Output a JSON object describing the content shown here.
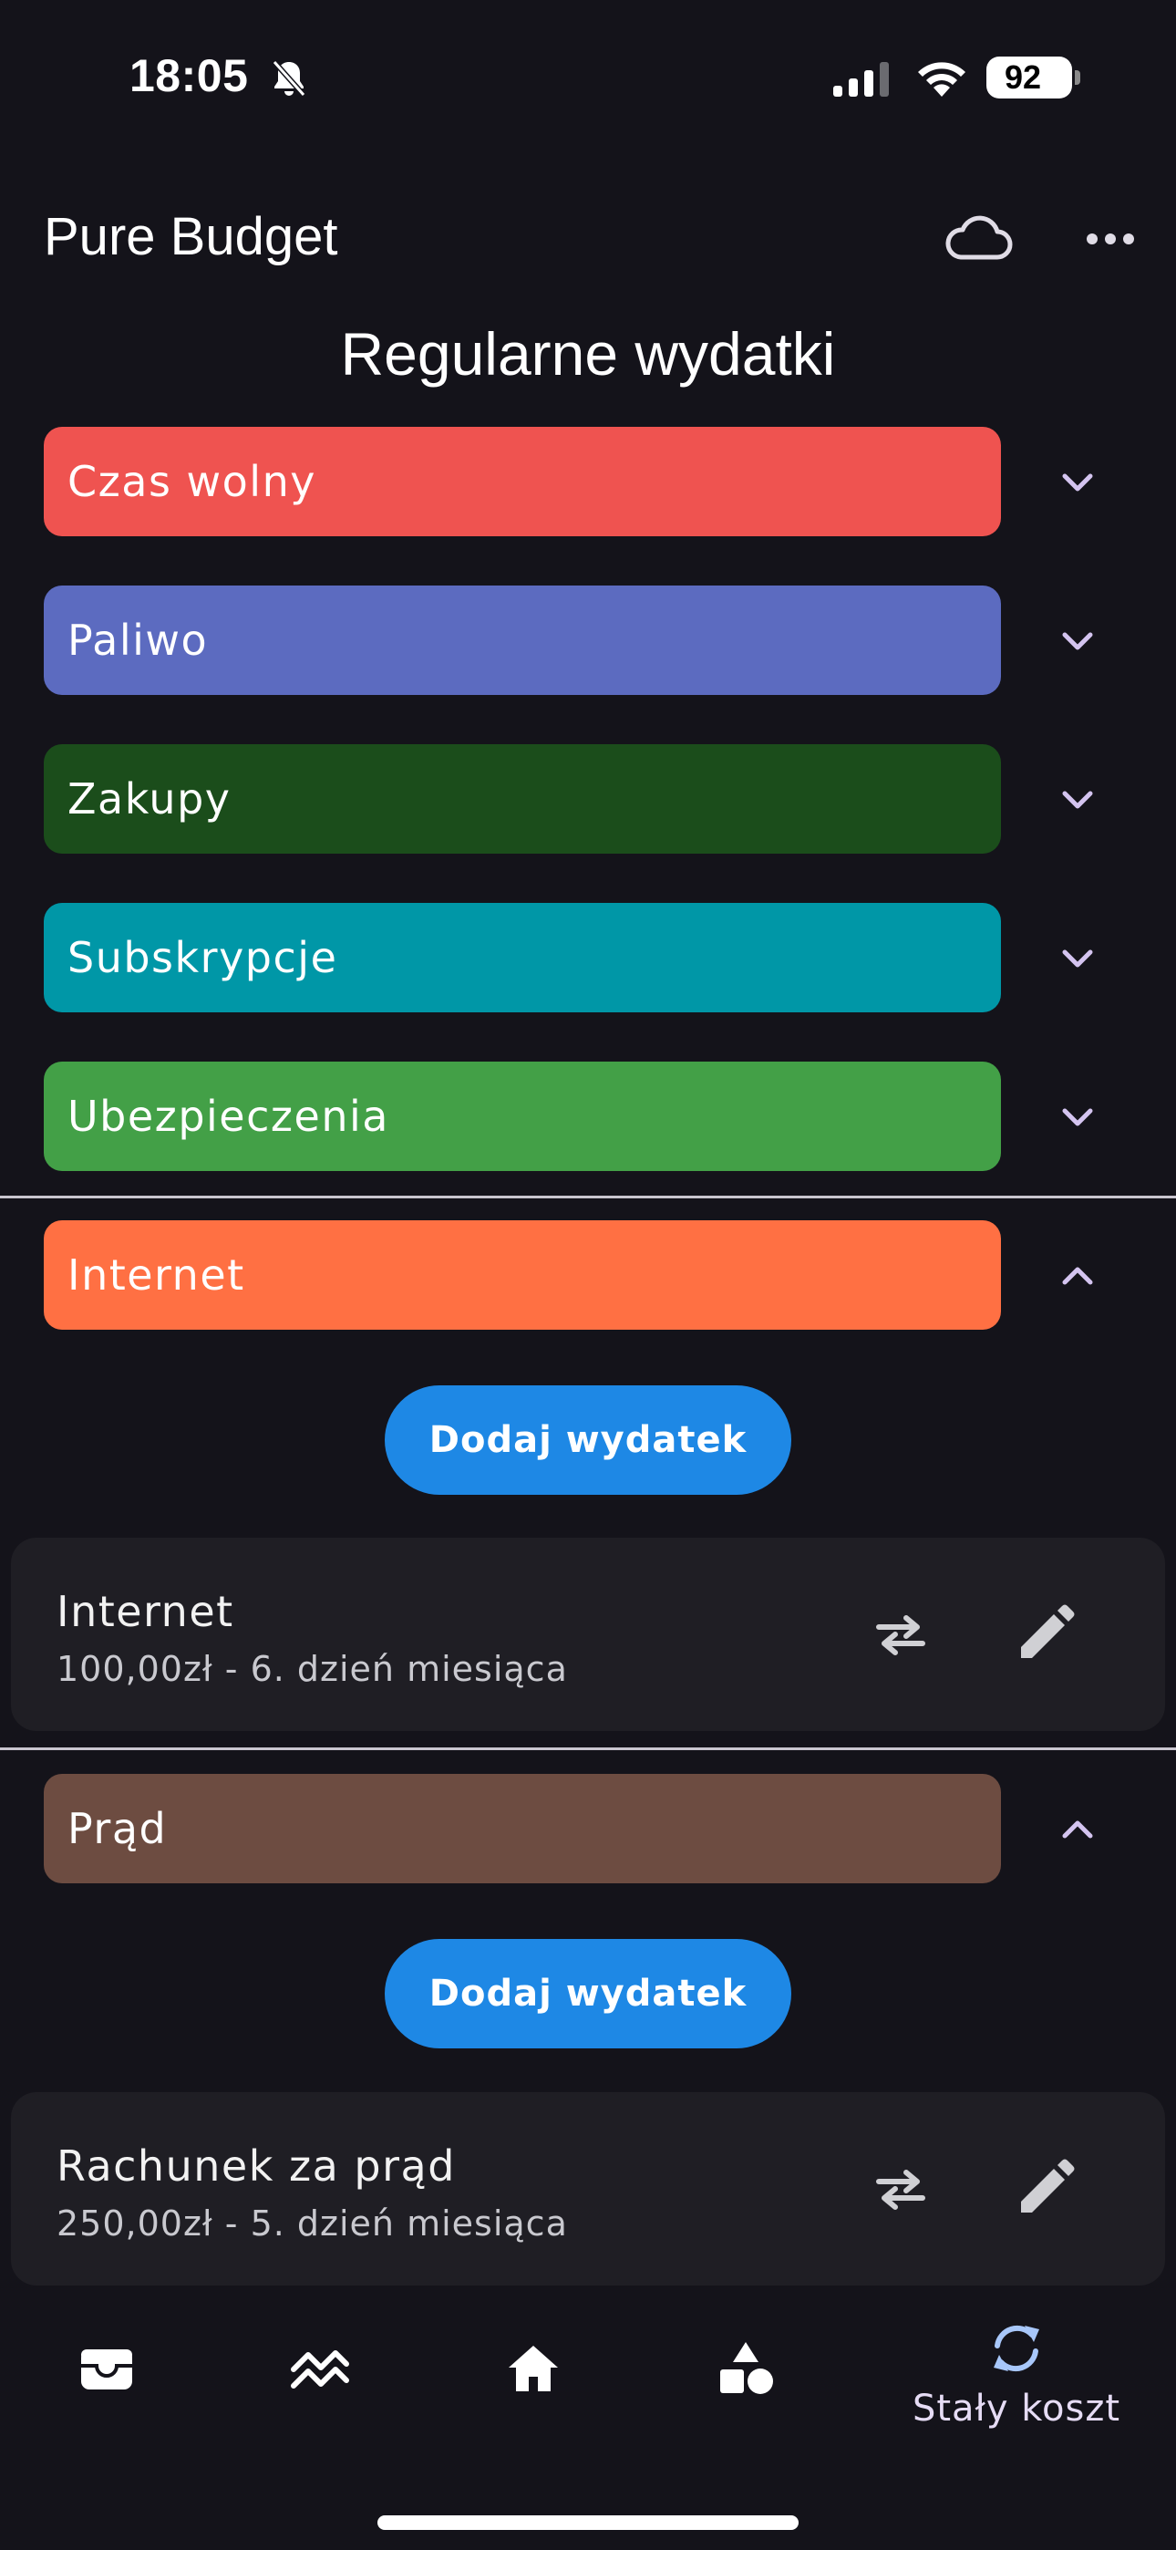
{
  "status_bar": {
    "time": "18:05",
    "battery": "92"
  },
  "app": {
    "title": "Pure Budget"
  },
  "page": {
    "title": "Regularne wydatki"
  },
  "categories": [
    {
      "label": "Czas wolny",
      "color": "#ef5350",
      "expanded": false
    },
    {
      "label": "Paliwo",
      "color": "#5c6bc0",
      "expanded": false
    },
    {
      "label": "Zakupy",
      "color": "#1b4d1b",
      "expanded": false
    },
    {
      "label": "Subskrypcje",
      "color": "#0097a7",
      "expanded": false
    },
    {
      "label": "Ubezpieczenia",
      "color": "#43a047",
      "expanded": false
    },
    {
      "label": "Internet",
      "color": "#ff7043",
      "expanded": true
    },
    {
      "label": "Prąd",
      "color": "#6d4c41",
      "expanded": true
    }
  ],
  "add_button_label": "Dodaj wydatek",
  "expenses": {
    "internet": {
      "name": "Internet",
      "detail": "100,00zł - 6. dzień miesiąca"
    },
    "prad": {
      "name": "Rachunek za prąd",
      "detail": "250,00zł - 5. dzień miesiąca"
    }
  },
  "nav": {
    "items": [
      {
        "icon": "wallet-icon"
      },
      {
        "icon": "trend-icon"
      },
      {
        "icon": "home-icon"
      },
      {
        "icon": "shapes-icon"
      },
      {
        "icon": "sync-icon",
        "label": "Stały koszt",
        "active": true
      }
    ]
  },
  "colors": {
    "background": "#14131a",
    "card": "#1f1e24",
    "button": "#1e88e5",
    "chevron": "#d4c4f0",
    "nav_active": "#a8c7fa"
  }
}
